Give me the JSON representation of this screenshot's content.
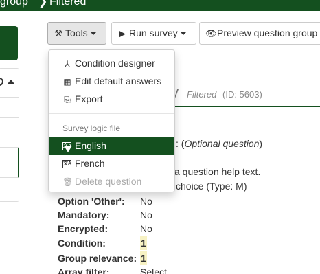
{
  "breadcrumb": {
    "previous": "group",
    "separator": "❯",
    "current": "Filtered"
  },
  "toolbar": {
    "tools_label": "Tools",
    "run_survey_label": "Run survey",
    "preview_label": "Preview question group"
  },
  "header": {
    "title_fragment": "y",
    "filtered": "Filtered",
    "id_text": "(ID: 5603)"
  },
  "content": {
    "optional_prefix": ": (",
    "optional_text": "Optional question",
    "optional_suffix": ")",
    "help_text": "a question help text.",
    "type_text": "choice (Type: M)"
  },
  "properties": [
    {
      "key": "Option 'Other':",
      "value": "No"
    },
    {
      "key": "Mandatory:",
      "value": "No"
    },
    {
      "key": "Encrypted:",
      "value": "No"
    },
    {
      "key": "Condition:",
      "value": "1"
    },
    {
      "key": "Group relevance:",
      "value": "1"
    },
    {
      "key": "Array filter:",
      "value": "Select"
    }
  ],
  "tools_menu": {
    "items": [
      {
        "label": "Condition designer",
        "icon": "condition-icon"
      },
      {
        "label": "Edit default answers",
        "icon": "table-icon"
      },
      {
        "label": "Export",
        "icon": "export-icon"
      }
    ],
    "section_header": "Survey logic file",
    "languages": [
      {
        "label": "English",
        "icon": "language-icon",
        "selected": true
      },
      {
        "label": "French",
        "icon": "language-icon",
        "selected": false
      }
    ],
    "delete_label": "Delete question"
  },
  "colors": {
    "brand": "#14501f",
    "highlight": "#f7f2c4"
  }
}
